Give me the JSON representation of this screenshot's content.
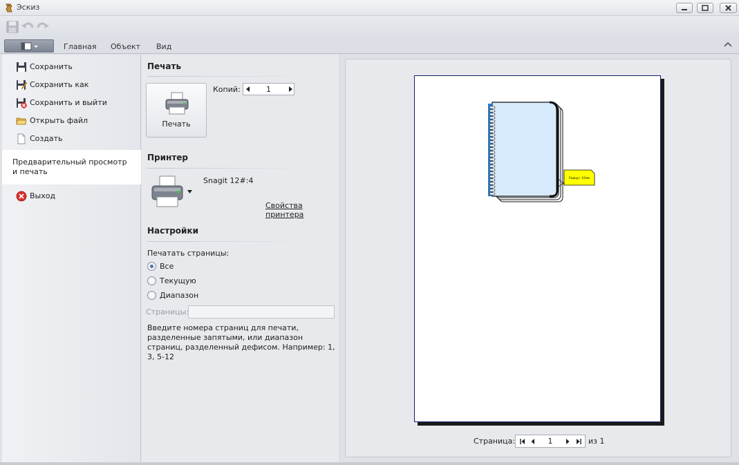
{
  "window": {
    "title": "Эскиз"
  },
  "ribbon": {
    "tabs": [
      "Главная",
      "Объект",
      "Вид"
    ]
  },
  "left_menu": {
    "items": [
      {
        "label": "Сохранить",
        "icon": "floppy-disk-icon"
      },
      {
        "label": "Сохранить как",
        "icon": "save-as-icon"
      },
      {
        "label": "Сохранить и выйти",
        "icon": "save-and-exit-icon"
      },
      {
        "label": "Открыть файл",
        "icon": "folder-open-icon"
      },
      {
        "label": "Создать",
        "icon": "new-document-icon"
      },
      {
        "label": "Предварительный просмотр и печать",
        "active": true
      },
      {
        "label": "Выход",
        "icon": "exit-icon"
      }
    ]
  },
  "print_section": {
    "title": "Печать",
    "print_button": "Печать",
    "copies_label": "Копий:",
    "copies_value": "1"
  },
  "printer_section": {
    "title": "Принтер",
    "printer_name": "Snagit 12#:4",
    "properties_link": "Свойства принтера"
  },
  "settings_section": {
    "title": "Настройки",
    "print_pages_label": "Печатать страницы:",
    "options": [
      {
        "label": "Все",
        "checked": true
      },
      {
        "label": "Текущую",
        "checked": false
      },
      {
        "label": "Диапазон",
        "checked": false
      }
    ],
    "pages_label": "Страницы:",
    "pages_value": "",
    "hint": "Введите номера страниц для печати, разделенные запятыми, или диапазон страниц, разделенный дефисом. Например: 1, 3, 5-12"
  },
  "preview": {
    "callout_text": "Радиус: 10мм",
    "page_label": "Страница:",
    "page_value": "1",
    "page_total": "из 1"
  },
  "colors": {
    "accent": "#4a6fb0",
    "notebook_fill": "#d7eafb",
    "callout_fill": "#ffff00",
    "page_border": "#151a6a"
  }
}
